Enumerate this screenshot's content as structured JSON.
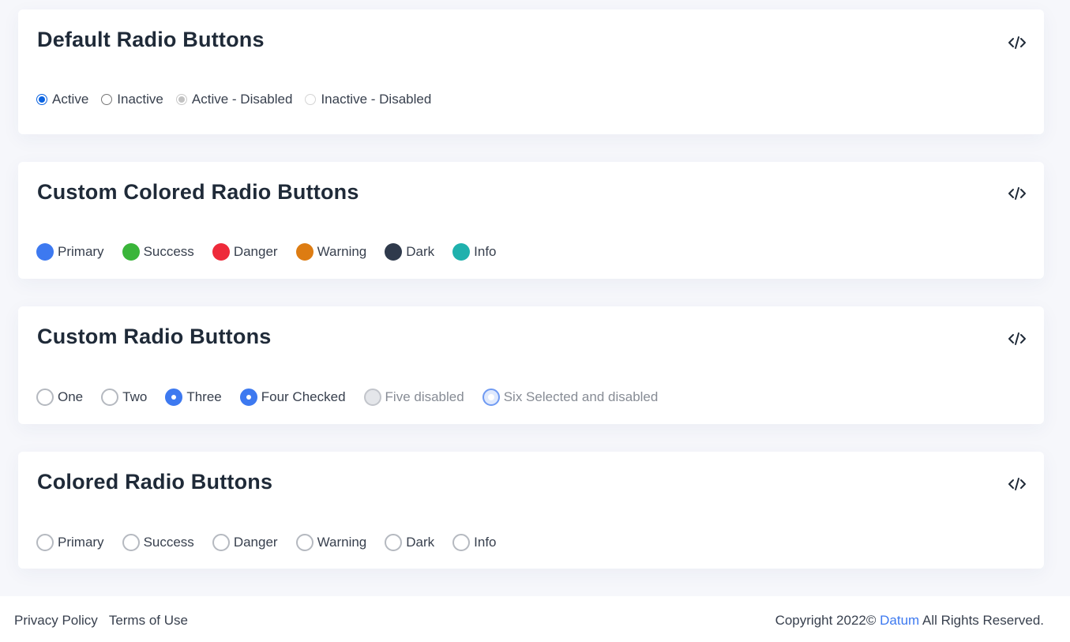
{
  "sections": [
    {
      "title": "Default Radio Buttons",
      "options": [
        {
          "label": "Active",
          "state": "checked"
        },
        {
          "label": "Inactive",
          "state": "unchecked"
        },
        {
          "label": "Active - Disabled",
          "state": "checked-disabled"
        },
        {
          "label": "Inactive - Disabled",
          "state": "unchecked-disabled"
        }
      ]
    },
    {
      "title": "Custom Colored Radio Buttons",
      "options": [
        {
          "label": "Primary",
          "color": "#3d79f0"
        },
        {
          "label": "Success",
          "color": "#3ab53a"
        },
        {
          "label": "Danger",
          "color": "#ee2a3a"
        },
        {
          "label": "Warning",
          "color": "#dd7c12"
        },
        {
          "label": "Dark",
          "color": "#2f3a4c"
        },
        {
          "label": "Info",
          "color": "#1fb1ad"
        }
      ]
    },
    {
      "title": "Custom Radio Buttons",
      "options": [
        {
          "label": "One",
          "state": "unchecked"
        },
        {
          "label": "Two",
          "state": "unchecked"
        },
        {
          "label": "Three",
          "state": "checked"
        },
        {
          "label": "Four Checked",
          "state": "checked"
        },
        {
          "label": "Five disabled",
          "state": "disabled"
        },
        {
          "label": "Six Selected and disabled",
          "state": "selected-disabled"
        }
      ]
    },
    {
      "title": "Colored Radio Buttons",
      "options": [
        {
          "label": "Primary",
          "state": "unchecked"
        },
        {
          "label": "Success",
          "state": "unchecked"
        },
        {
          "label": "Danger",
          "state": "unchecked"
        },
        {
          "label": "Warning",
          "state": "unchecked"
        },
        {
          "label": "Dark",
          "state": "unchecked"
        },
        {
          "label": "Info",
          "state": "unchecked"
        }
      ]
    }
  ],
  "icons": {
    "code": "code-brackets-icon"
  },
  "footer": {
    "privacy": "Privacy Policy",
    "terms": "Terms of Use",
    "copyright_prefix": "Copyright 2022© ",
    "brand": "Datum",
    "copyright_suffix": " All Rights Reserved."
  },
  "colors": {
    "accent": "#3d79f0",
    "page_bg": "#f6f7fb"
  }
}
